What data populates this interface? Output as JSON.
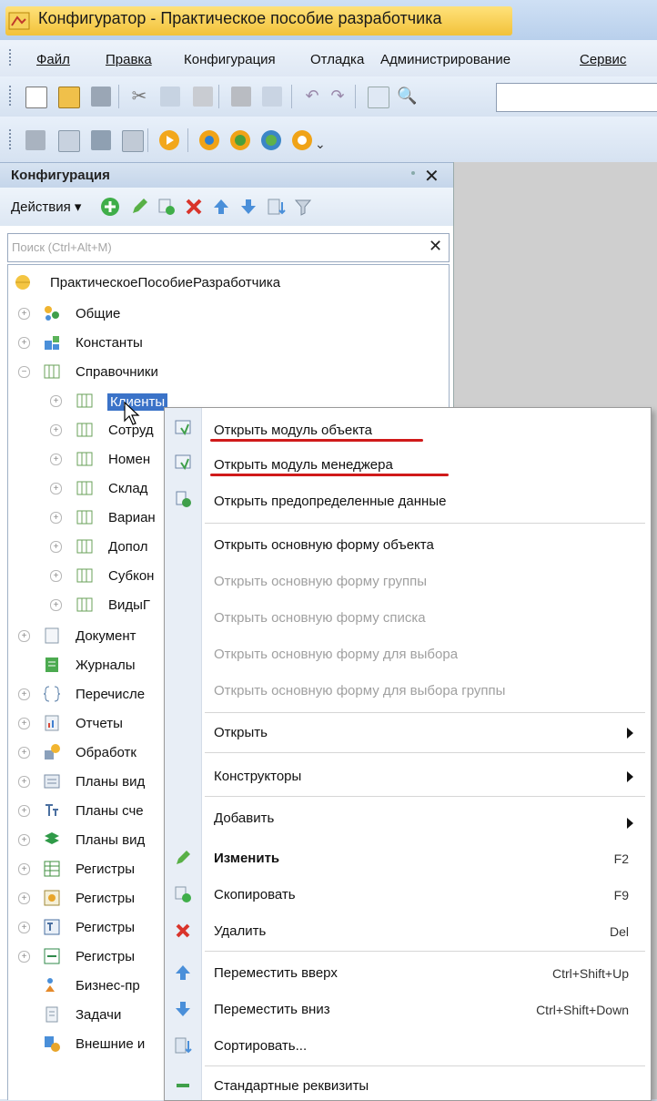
{
  "window": {
    "title": "Конфигуратор - Практическое пособие разработчика"
  },
  "menu": [
    {
      "label": "Файл",
      "u": "Ф"
    },
    {
      "label": "Правка",
      "u": "П"
    },
    {
      "label": "Конфигурация"
    },
    {
      "label": "Отладка"
    },
    {
      "label": "Администрирование"
    },
    {
      "label": "Сервис",
      "u": "С"
    }
  ],
  "config_panel": {
    "title": "Конфигурация",
    "actions_label": "Действия",
    "search_placeholder": "Поиск (Ctrl+Alt+M)"
  },
  "tree": {
    "root": "ПрактическоеПособиеРазработчика",
    "items": [
      {
        "label": "Общие",
        "icon": "common-icon"
      },
      {
        "label": "Константы",
        "icon": "constants-icon"
      },
      {
        "label": "Справочники",
        "icon": "catalogs-icon"
      },
      {
        "label": "Клиенты",
        "icon": "catalog-icon"
      },
      {
        "label": "Сотруд",
        "icon": "catalog-icon"
      },
      {
        "label": "Номен",
        "icon": "catalog-icon"
      },
      {
        "label": "Склад",
        "icon": "catalog-icon"
      },
      {
        "label": "Вариан",
        "icon": "catalog-icon"
      },
      {
        "label": "Допол",
        "icon": "catalog-icon"
      },
      {
        "label": "Субкон",
        "icon": "catalog-icon"
      },
      {
        "label": "ВидыГ",
        "icon": "catalog-icon"
      },
      {
        "label": "Документ",
        "icon": "documents-icon"
      },
      {
        "label": "Журналы",
        "icon": "journals-icon"
      },
      {
        "label": "Перечисле",
        "icon": "enums-icon"
      },
      {
        "label": "Отчеты",
        "icon": "reports-icon"
      },
      {
        "label": "Обработк",
        "icon": "dataprocessors-icon"
      },
      {
        "label": "Планы вид",
        "icon": "chart-of-characteristics-icon"
      },
      {
        "label": "Планы сче",
        "icon": "chart-of-accounts-icon"
      },
      {
        "label": "Планы вид",
        "icon": "chart-of-calc-types-icon"
      },
      {
        "label": "Регистры",
        "icon": "info-registers-icon"
      },
      {
        "label": "Регистры",
        "icon": "accumulation-registers-icon"
      },
      {
        "label": "Регистры",
        "icon": "accounting-registers-icon"
      },
      {
        "label": "Регистры",
        "icon": "calculation-registers-icon"
      },
      {
        "label": "Бизнес-пр",
        "icon": "business-processes-icon"
      },
      {
        "label": "Задачи",
        "icon": "tasks-icon"
      },
      {
        "label": "Внешние и",
        "icon": "external-sources-icon"
      }
    ]
  },
  "context_menu": {
    "items": [
      {
        "label": "Открыть модуль объекта",
        "icon": "module-icon"
      },
      {
        "label": "Открыть модуль менеджера",
        "icon": "module-icon"
      },
      {
        "label": "Открыть предопределенные данные",
        "icon": "predefined-icon"
      },
      {
        "label": "Открыть основную форму объекта"
      },
      {
        "label": "Открыть основную форму группы"
      },
      {
        "label": "Открыть основную форму списка"
      },
      {
        "label": "Открыть основную форму для выбора"
      },
      {
        "label": "Открыть основную форму для выбора группы"
      },
      {
        "label": "Открыть"
      },
      {
        "label": "Конструкторы"
      },
      {
        "label": "Добавить"
      },
      {
        "label": "Изменить",
        "shortcut": "F2",
        "icon": "pencil-icon"
      },
      {
        "label": "Скопировать",
        "shortcut": "F9",
        "icon": "copy-icon"
      },
      {
        "label": "Удалить",
        "shortcut": "Del",
        "icon": "delete-icon"
      },
      {
        "label": "Переместить вверх",
        "shortcut": "Ctrl+Shift+Up",
        "icon": "arrow-up-icon"
      },
      {
        "label": "Переместить вниз",
        "shortcut": "Ctrl+Shift+Down",
        "icon": "arrow-down-icon"
      },
      {
        "label": "Сортировать...",
        "icon": "sort-icon"
      },
      {
        "label": "Стандартные реквизиты",
        "icon": "standard-attributes-icon"
      }
    ]
  },
  "colors": {
    "highlight": "#d01a1a",
    "selection": "#3b73c8"
  }
}
